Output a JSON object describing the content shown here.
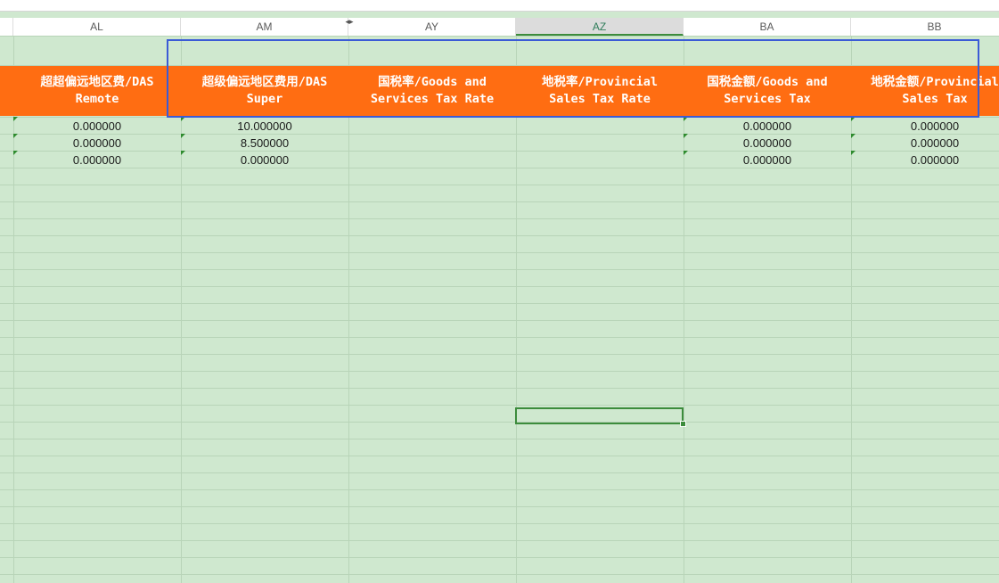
{
  "columns": {
    "al": "AL",
    "am": "AM",
    "ay": "AY",
    "az": "AZ",
    "ba": "BA",
    "bb": "BB"
  },
  "selected_column": "AZ",
  "headers": {
    "al": "超超偏远地区费/DAS\nRemote",
    "am": "超级偏远地区费用/DAS\nSuper",
    "ay": "国税率/Goods and\nServices Tax Rate",
    "az": "地税率/Provincial\nSales Tax Rate",
    "ba": "国税金额/Goods and\nServices Tax",
    "bb": "地税金额/Provincial\nSales Tax"
  },
  "rows": [
    {
      "al": "0.000000",
      "am": "10.000000",
      "ay": "",
      "az": "",
      "ba": "0.000000",
      "bb": "0.000000"
    },
    {
      "al": "0.000000",
      "am": "8.500000",
      "ay": "",
      "az": "",
      "ba": "0.000000",
      "bb": "0.000000"
    },
    {
      "al": "0.000000",
      "am": "0.000000",
      "ay": "",
      "az": "",
      "ba": "0.000000",
      "bb": "0.000000"
    }
  ],
  "icons": {
    "column_resize": "column-resize-arrows",
    "error_flag": "green-triangle-flag"
  },
  "colors": {
    "sheet_background": "#cfe8cf",
    "header_fill": "#ff6d12",
    "header_text": "#ffffff",
    "highlight_border": "#3b5bd6",
    "active_cell_border": "#3c8c3c"
  }
}
